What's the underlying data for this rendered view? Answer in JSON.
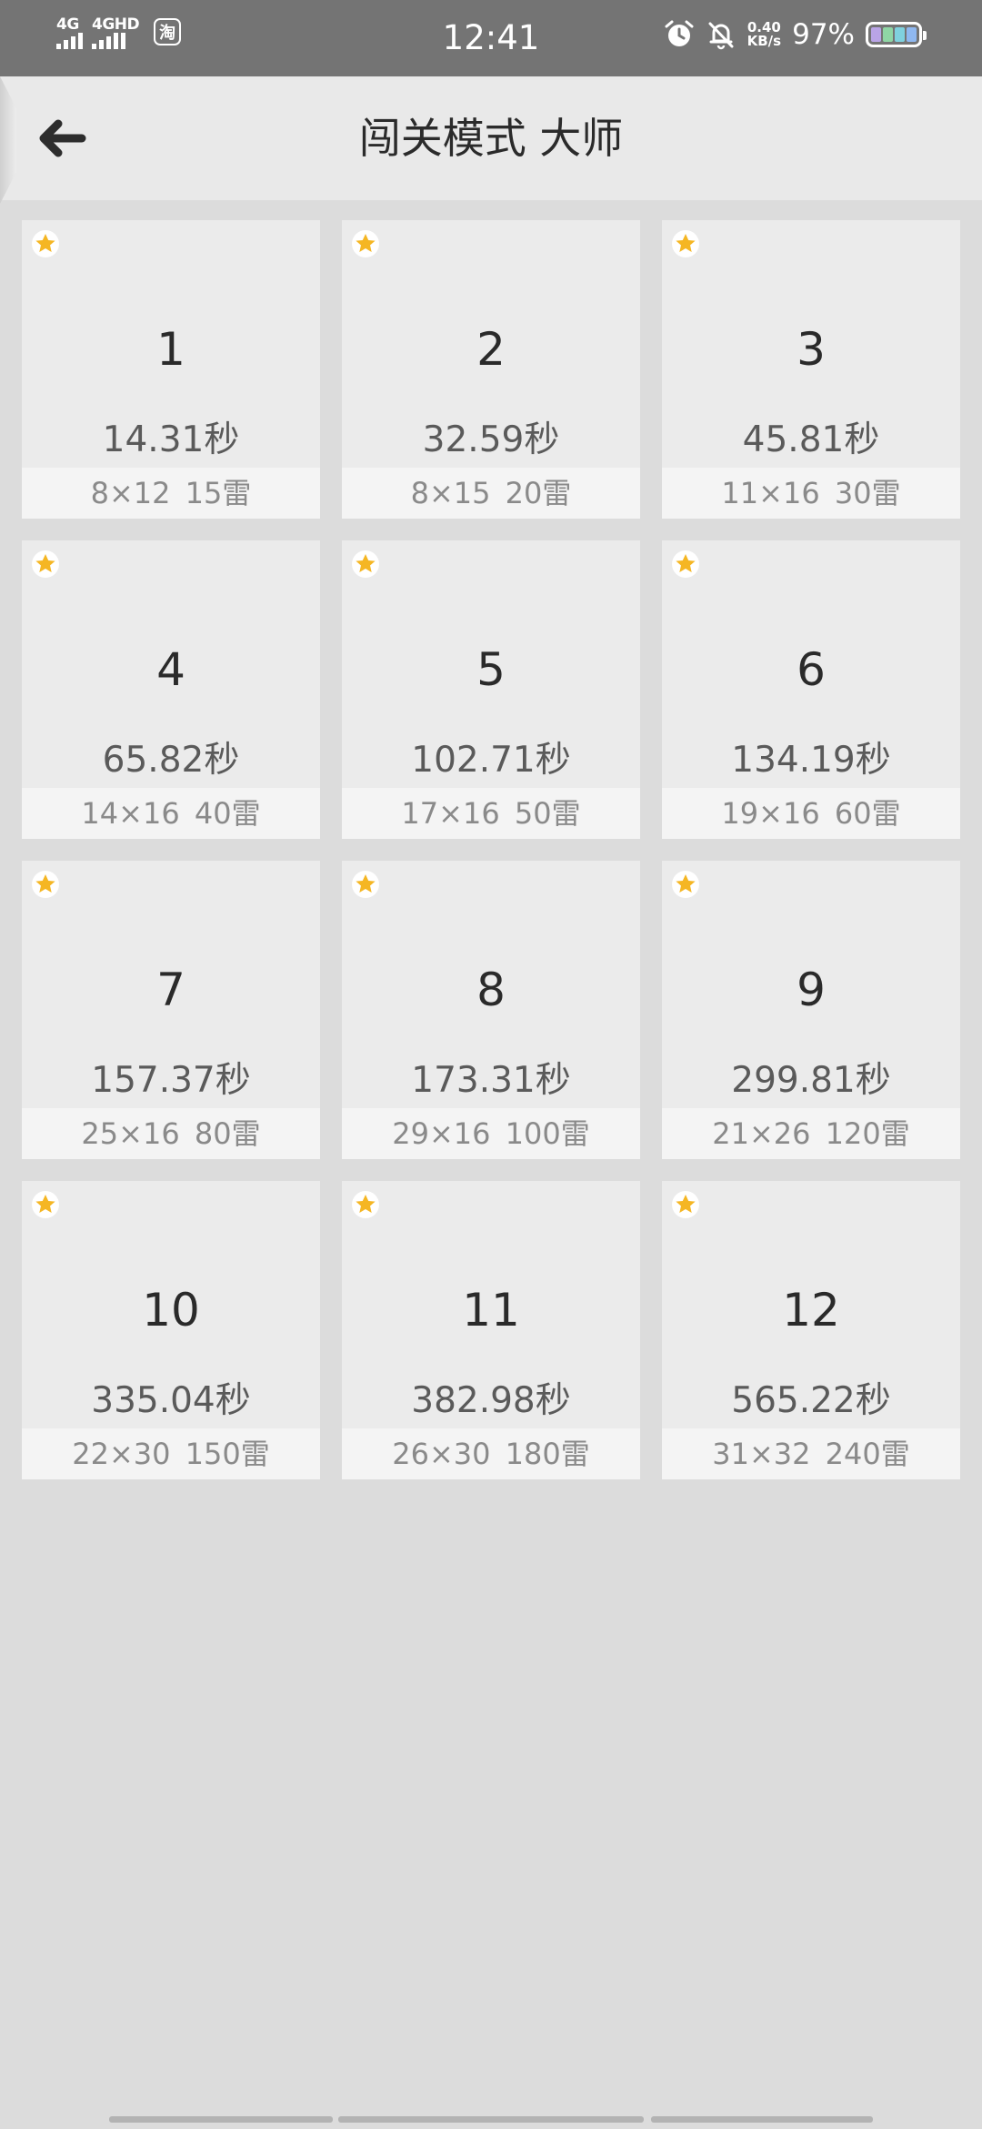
{
  "status_bar": {
    "signal1_label": "4G",
    "signal2_label": "4GHD",
    "app_badge": "淘",
    "time": "12:41",
    "net_speed_value": "0.40",
    "net_speed_unit": "KB/s",
    "battery_percent": "97%",
    "icons": [
      "signal-icon",
      "signal-icon",
      "taobao-icon",
      "alarm-icon",
      "bell-off-icon",
      "battery-icon"
    ],
    "battery_colors": [
      "#b9a4e6",
      "#8fd6a5",
      "#7fd1de",
      "#8fb8f0"
    ]
  },
  "header": {
    "title": "闯关模式 大师",
    "back_icon": "arrow-left-icon"
  },
  "accent": {
    "star_color": "#f5b623",
    "card_background": "#ebebeb",
    "footer_background": "#f4f4f4"
  },
  "levels": [
    {
      "number": "1",
      "time": "14.31秒",
      "info": "8×12  15雷",
      "starred": true
    },
    {
      "number": "2",
      "time": "32.59秒",
      "info": "8×15  20雷",
      "starred": true
    },
    {
      "number": "3",
      "time": "45.81秒",
      "info": "11×16  30雷",
      "starred": true
    },
    {
      "number": "4",
      "time": "65.82秒",
      "info": "14×16  40雷",
      "starred": true
    },
    {
      "number": "5",
      "time": "102.71秒",
      "info": "17×16  50雷",
      "starred": true
    },
    {
      "number": "6",
      "time": "134.19秒",
      "info": "19×16  60雷",
      "starred": true
    },
    {
      "number": "7",
      "time": "157.37秒",
      "info": "25×16  80雷",
      "starred": true
    },
    {
      "number": "8",
      "time": "173.31秒",
      "info": "29×16  100雷",
      "starred": true
    },
    {
      "number": "9",
      "time": "299.81秒",
      "info": "21×26  120雷",
      "starred": true
    },
    {
      "number": "10",
      "time": "335.04秒",
      "info": "22×30  150雷",
      "starred": true
    },
    {
      "number": "11",
      "time": "382.98秒",
      "info": "26×30  180雷",
      "starred": true
    },
    {
      "number": "12",
      "time": "565.22秒",
      "info": "31×32  240雷",
      "starred": true
    }
  ]
}
